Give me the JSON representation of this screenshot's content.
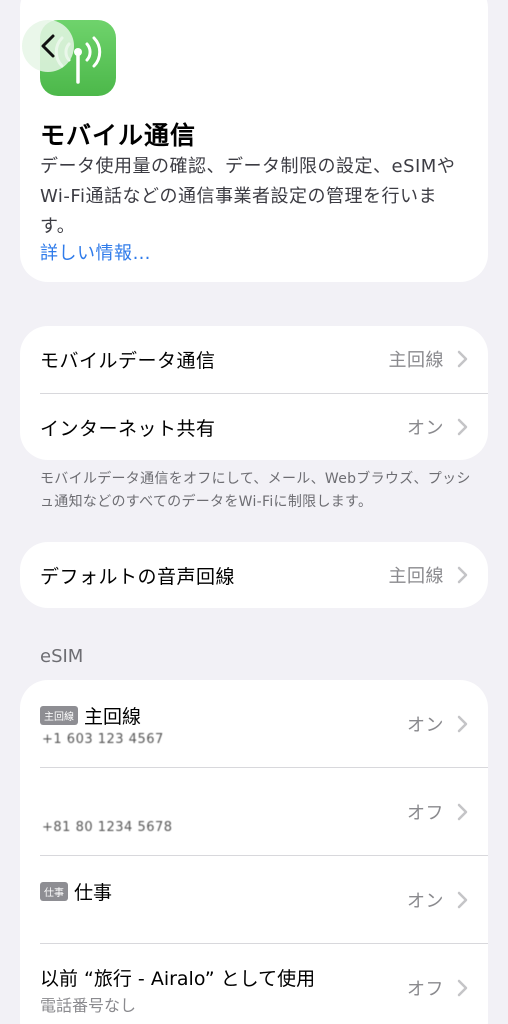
{
  "header": {
    "back_icon": "chevron-left-icon",
    "app_icon": "antenna-icon",
    "title": "モバイル通信",
    "description": "データ使用量の確認、データ制限の設定、eSIMやWi-Fi通話などの通信事業者設定の管理を行います。",
    "link": "詳しい情報…"
  },
  "group1": {
    "rows": [
      {
        "label": "モバイルデータ通信",
        "value": "主回線"
      },
      {
        "label": "インターネット共有",
        "value": "オン"
      }
    ],
    "footnote": "モバイルデータ通信をオフにして、メール、Webブラウズ、プッシュ通知などのすべてのデータをWi-Fiに制限します。"
  },
  "group2": {
    "rows": [
      {
        "label": "デフォルトの音声回線",
        "value": "主回線"
      }
    ]
  },
  "esim": {
    "section_title": "eSIM",
    "lines": [
      {
        "badge": "主回線",
        "name": "主回線",
        "number": "+1 603 123 4567",
        "value": "オン"
      },
      {
        "badge": "",
        "name": "",
        "number": "+81 80 1234 5678",
        "value": "オフ"
      },
      {
        "badge": "仕事",
        "name": "仕事",
        "number": "",
        "value": "オン"
      },
      {
        "badge": "",
        "name": "以前 “旅行 - Airalo” として使用",
        "sub": "電話番号なし",
        "value": "オフ"
      }
    ]
  },
  "colors": {
    "background": "#f2f1f6",
    "link": "#2f7bea",
    "app_icon": "#4cb84a"
  }
}
